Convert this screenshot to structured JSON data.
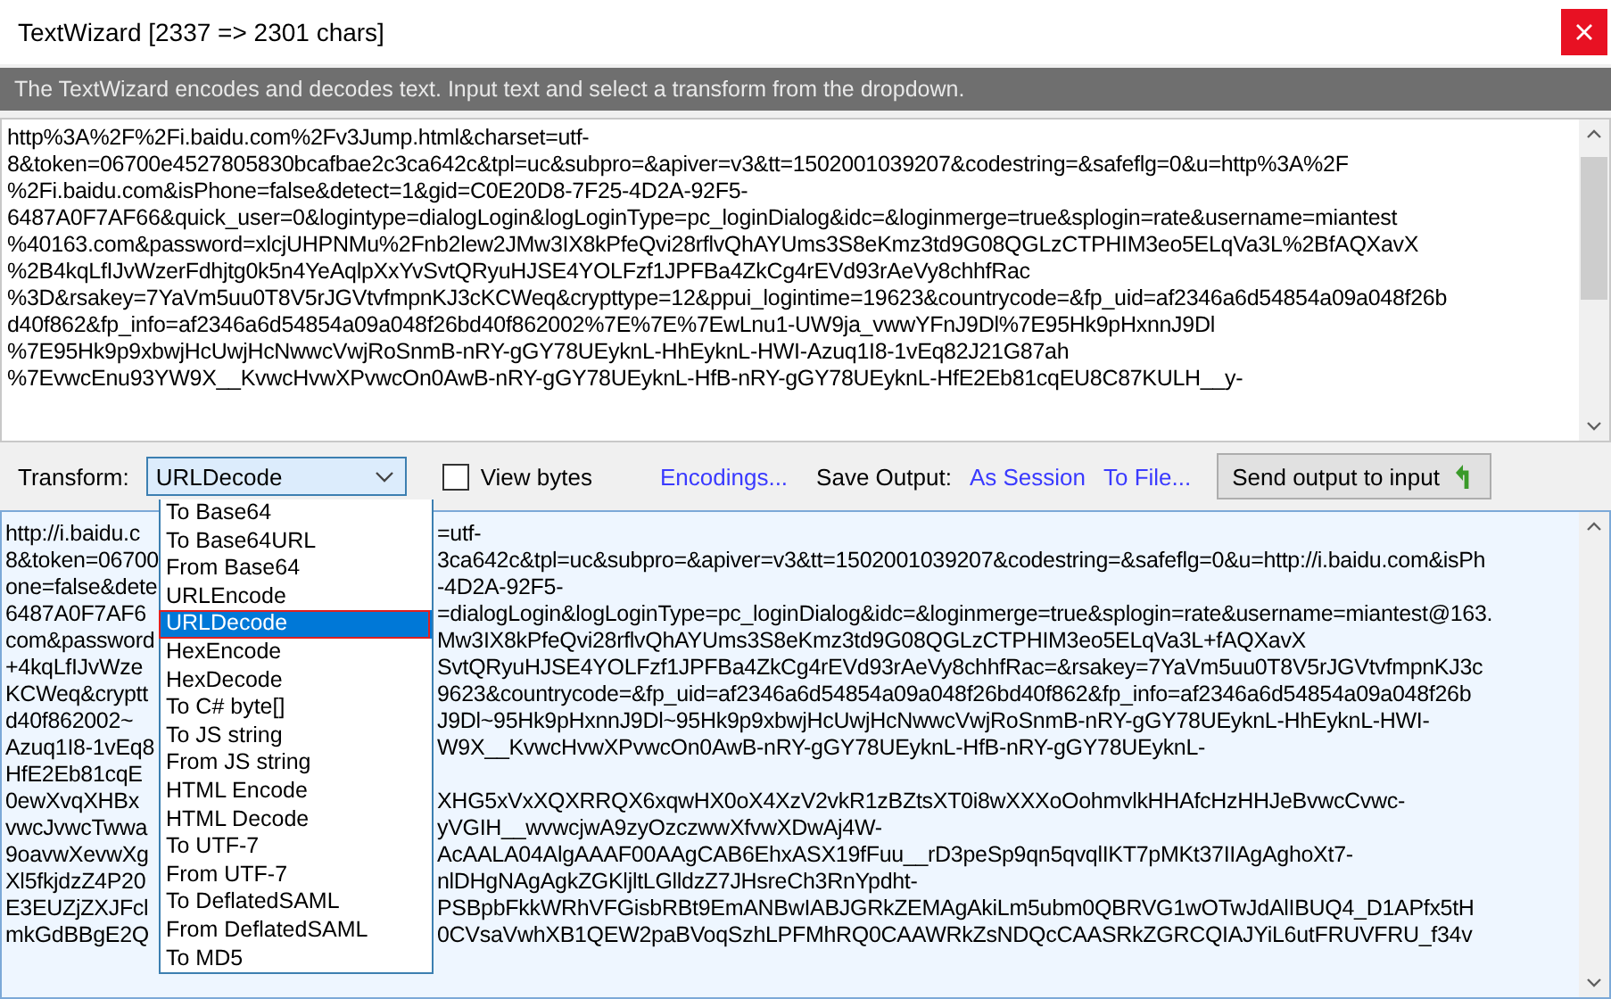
{
  "window": {
    "title": "TextWizard [2337 => 2301 chars]"
  },
  "description": "The TextWizard encodes and decodes text. Input text and select a transform from the dropdown.",
  "input": {
    "lines": [
      "http%3A%2F%2Fi.baidu.com%2Fv3Jump.html&charset=utf-",
      "8&token=06700e4527805830bcafbae2c3ca642c&tpl=uc&subpro=&apiver=v3&tt=1502001039207&codestring=&safeflg=0&u=http%3A%2F",
      "%2Fi.baidu.com&isPhone=false&detect=1&gid=C0E20D8-7F25-4D2A-92F5-",
      "6487A0F7AF66&quick_user=0&logintype=dialogLogin&logLoginType=pc_loginDialog&idc=&loginmerge=true&splogin=rate&username=miantest",
      "%40163.com&password=xlcjUHPNMu%2Fnb2lew2JMw3IX8kPfeQvi28rflvQhAYUms3S8eKmz3td9G08QGLzCTPHIM3eo5ELqVa3L%2BfAQXavX",
      "%2B4kqLfIJvWzerFdhjtg0k5n4YeAqlpXxYvSvtQRyuHJSE4YOLFzf1JPFBa4ZkCg4rEVd93rAeVy8chhfRac",
      "%3D&rsakey=7YaVm5uu0T8V5rJGVtvfmpnKJ3cKCWeq&crypttype=12&ppui_logintime=19623&countrycode=&fp_uid=af2346a6d54854a09a048f26b",
      "d40f862&fp_info=af2346a6d54854a09a048f26bd40f862002%7E%7E%7EwLnu1-UW9ja_vwwYFnJ9Dl%7E95Hk9pHxnnJ9Dl",
      "%7E95Hk9p9xbwjHcUwjHcNwwcVwjRoSnmB-nRY-gGY78UEyknL-HhEyknL-HWI-Azuq1I8-1vEq82J21G87ah",
      "%7EvwcEnu93YW9X__KvwcHvwXPvwcOn0AwB-nRY-gGY78UEyknL-HfB-nRY-gGY78UEyknL-HfE2Eb81cqEU8C87KULH__y-"
    ]
  },
  "toolbar": {
    "transform_label": "Transform:",
    "transform_value": "URLDecode",
    "view_bytes": {
      "label": "View bytes",
      "checked": false
    },
    "encodings_link": "Encodings...",
    "save_label": "Save Output:",
    "session_link": "As Session",
    "file_link": "To File...",
    "send_button": "Send output to input"
  },
  "dropdown": [
    {
      "label": "To Base64",
      "selected": false
    },
    {
      "label": "To Base64URL",
      "selected": false
    },
    {
      "label": "From Base64",
      "selected": false
    },
    {
      "label": "URLEncode",
      "selected": false
    },
    {
      "label": "URLDecode",
      "selected": true
    },
    {
      "label": "HexEncode",
      "selected": false
    },
    {
      "label": "HexDecode",
      "selected": false
    },
    {
      "label": "To C# byte[]",
      "selected": false
    },
    {
      "label": "To JS string",
      "selected": false
    },
    {
      "label": "From JS string",
      "selected": false
    },
    {
      "label": "HTML Encode",
      "selected": false
    },
    {
      "label": "HTML Decode",
      "selected": false
    },
    {
      "label": "To UTF-7",
      "selected": false
    },
    {
      "label": "From UTF-7",
      "selected": false
    },
    {
      "label": "To DeflatedSAML",
      "selected": false
    },
    {
      "label": "From DeflatedSAML",
      "selected": false
    },
    {
      "label": "To MD5",
      "selected": false
    }
  ],
  "output": {
    "lines": [
      {
        "left": "http://i.baidu.c",
        "right": "=utf-"
      },
      {
        "left": "8&token=06700",
        "right": "3ca642c&tpl=uc&subpro=&apiver=v3&tt=1502001039207&codestring=&safeflg=0&u=http://i.baidu.com&isPh"
      },
      {
        "left": "one=false&dete",
        "right": "-4D2A-92F5-"
      },
      {
        "left": "6487A0F7AF6",
        "right": "=dialogLogin&logLoginType=pc_loginDialog&idc=&loginmerge=true&splogin=rate&username=miantest@163."
      },
      {
        "left": "com&password",
        "right": "Mw3IX8kPfeQvi28rflvQhAYUms3S8eKmz3td9G08QGLzCTPHIM3eo5ELqVa3L+fAQXavX"
      },
      {
        "left": "+4kqLfIJvWze",
        "right": "SvtQRyuHJSE4YOLFzf1JPFBa4ZkCg4rEVd93rAeVy8chhfRac=&rsakey=7YaVm5uu0T8V5rJGVtvfmpnKJ3c"
      },
      {
        "left": "KCWeq&cryptt",
        "right": "9623&countrycode=&fp_uid=af2346a6d54854a09a048f26bd40f862&fp_info=af2346a6d54854a09a048f26b"
      },
      {
        "left": "d40f862002~",
        "right": "J9Dl~95Hk9pHxnnJ9Dl~95Hk9p9xbwjHcUwjHcNwwcVwjRoSnmB-nRY-gGY78UEyknL-HhEyknL-HWI-"
      },
      {
        "left": "Azuq1I8-1vEq8",
        "right": "W9X__KvwcHvwXPvwcOn0AwB-nRY-gGY78UEyknL-HfB-nRY-gGY78UEyknL-"
      },
      {
        "left": "HfE2Eb81cqE"
      },
      {
        "left": "0ewXvqXHBx",
        "right": "XHG5xVxXQXRRQX6xqwHX0oX4XzV2vkR1zBZtsXT0i8wXXXoOohmvlkHHAfcHzHHJeBvwcCvwc-"
      },
      {
        "left": "vwcJvwcTwwa",
        "right": "yVGIH__wvwcjwA9zyOzczwwXfvwXDwAj4W-"
      },
      {
        "left": "9oavwXevwXg",
        "right": "AcAALA04AlgAAAF00AAgCAB6EhxASX19fFuu__rD3peSp9qn5qvqlIKT7pMKt37IIAgAghoXt7-"
      },
      {
        "left": "Xl5fkjdzZ4P20",
        "right": "nlDHgNAgAgkZGKljltLGlldzZ7JHsreCh3RnYpdht-"
      },
      {
        "left": "E3EUZjZXJFcl",
        "right": "PSBpbFkkWRhVFGisbRBt9EmANBwIABJGRkZEMAgAkiLm5ubm0QBRVG1wOTwJdAlIBUQ4_D1APfx5tH"
      },
      {
        "left": "mkGdBBgE2Q",
        "right": "0CVsaVwhXB1QEW2paBVoqSzhLPFMhRQ0CAAWRkZsNDQcCAASRkZGRCQIAJYiL6utFRUVFRU_f34v"
      }
    ]
  }
}
